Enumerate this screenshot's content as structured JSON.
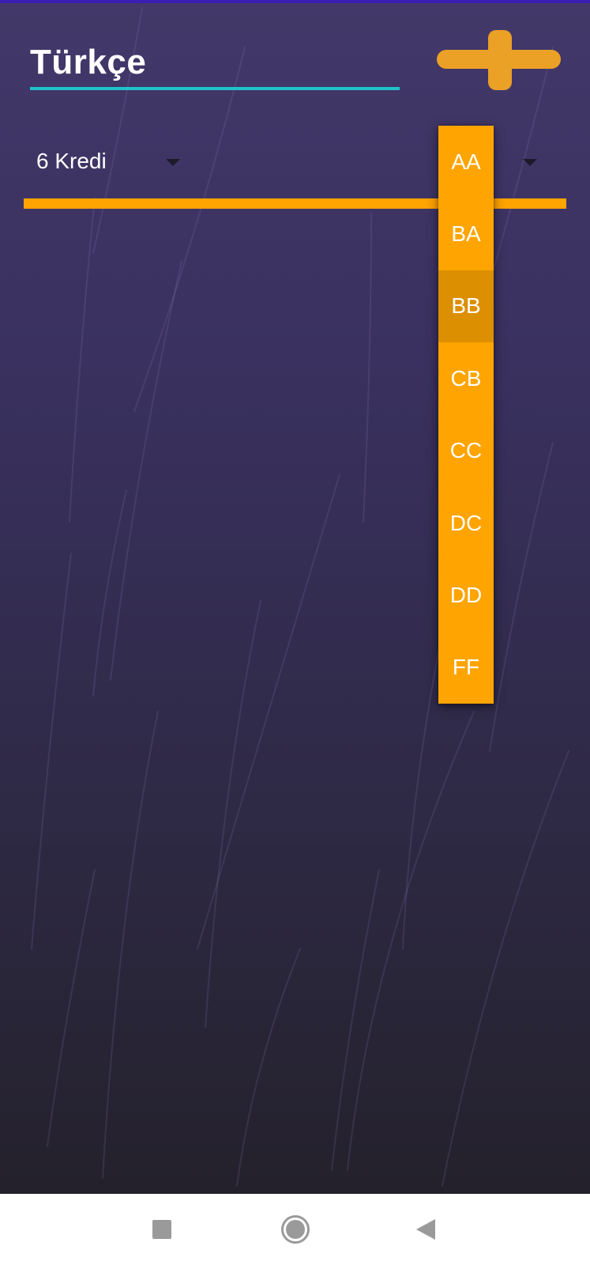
{
  "course": {
    "name": "Türkçe"
  },
  "credit": {
    "selected": "6 Kredi"
  },
  "grade_menu": {
    "options": [
      "AA",
      "BA",
      "BB",
      "CB",
      "CC",
      "DC",
      "DD",
      "FF"
    ],
    "highlighted": "BB"
  },
  "icons": {
    "add": "plus-icon",
    "credit_dropdown": "dropdown-arrow-icon",
    "grade_dropdown": "dropdown-arrow-icon",
    "nav_recents": "square-icon",
    "nav_home": "circle-icon",
    "nav_back": "back-triangle-icon"
  },
  "colors": {
    "accent": "#ffa400",
    "accent_pressed": "#dc8f00",
    "underline": "#1fc3c9",
    "status_strip": "#3b1fb5",
    "background_top": "#423869",
    "background_bottom": "#24212c"
  }
}
